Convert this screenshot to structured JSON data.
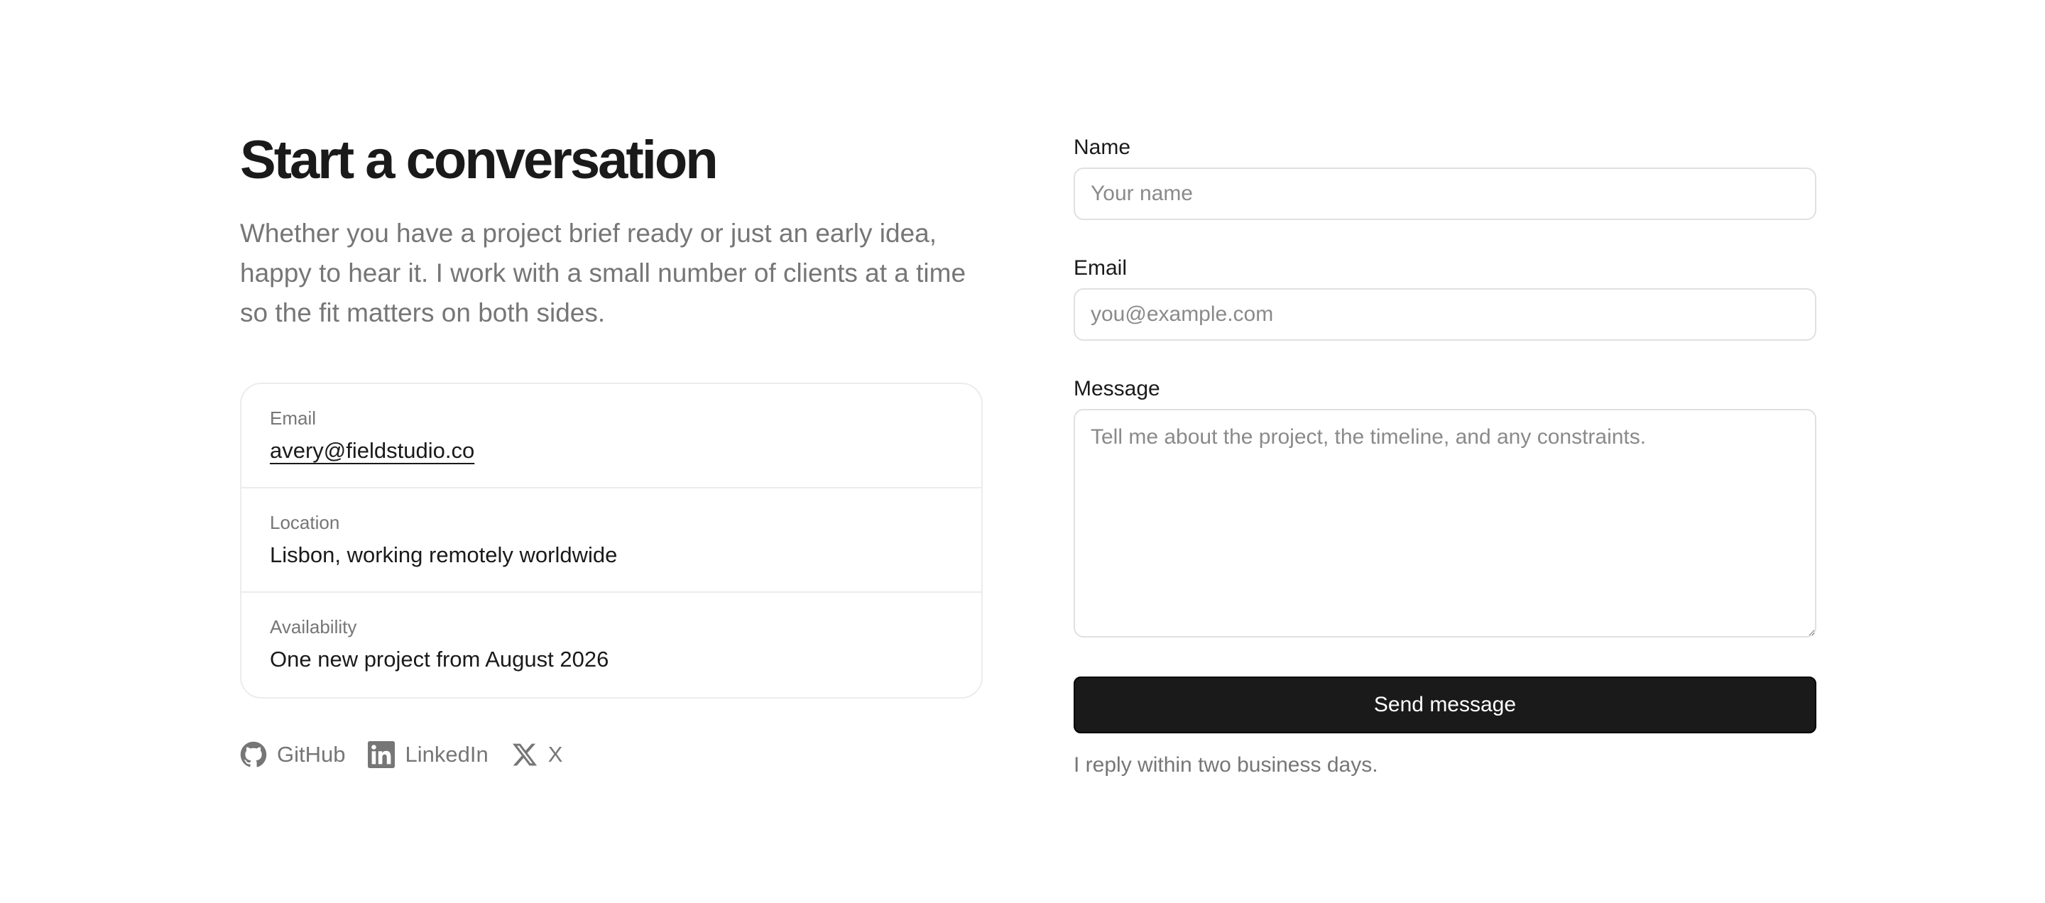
{
  "header": {
    "title": "Start a conversation",
    "intro": "Whether you have a project brief ready or just an early idea, happy to hear it. I work with a small number of clients at a time so the fit matters on both sides."
  },
  "contact_info": [
    {
      "label": "Email",
      "value": "avery@fieldstudio.co"
    },
    {
      "label": "Location",
      "value": "Lisbon, working remotely worldwide"
    },
    {
      "label": "Availability",
      "value": "One new project from August 2026"
    }
  ],
  "socials": [
    {
      "label": "GitHub",
      "icon": "github-icon"
    },
    {
      "label": "LinkedIn",
      "icon": "linkedin-icon"
    },
    {
      "label": "X",
      "icon": "x-icon"
    }
  ],
  "form": {
    "name_label": "Name",
    "name_placeholder": "Your name",
    "name_value": "",
    "email_label": "Email",
    "email_placeholder": "you@example.com",
    "email_value": "",
    "message_label": "Message",
    "message_placeholder": "Tell me about the project, the timeline, and any constraints.",
    "message_value": "",
    "submit_label": "Send message",
    "reply_note": "I reply within two business days."
  },
  "colors": {
    "text": "#1a1a1a",
    "muted": "#767676",
    "border": "#e0e0e0",
    "button": "#1a1a1a"
  }
}
